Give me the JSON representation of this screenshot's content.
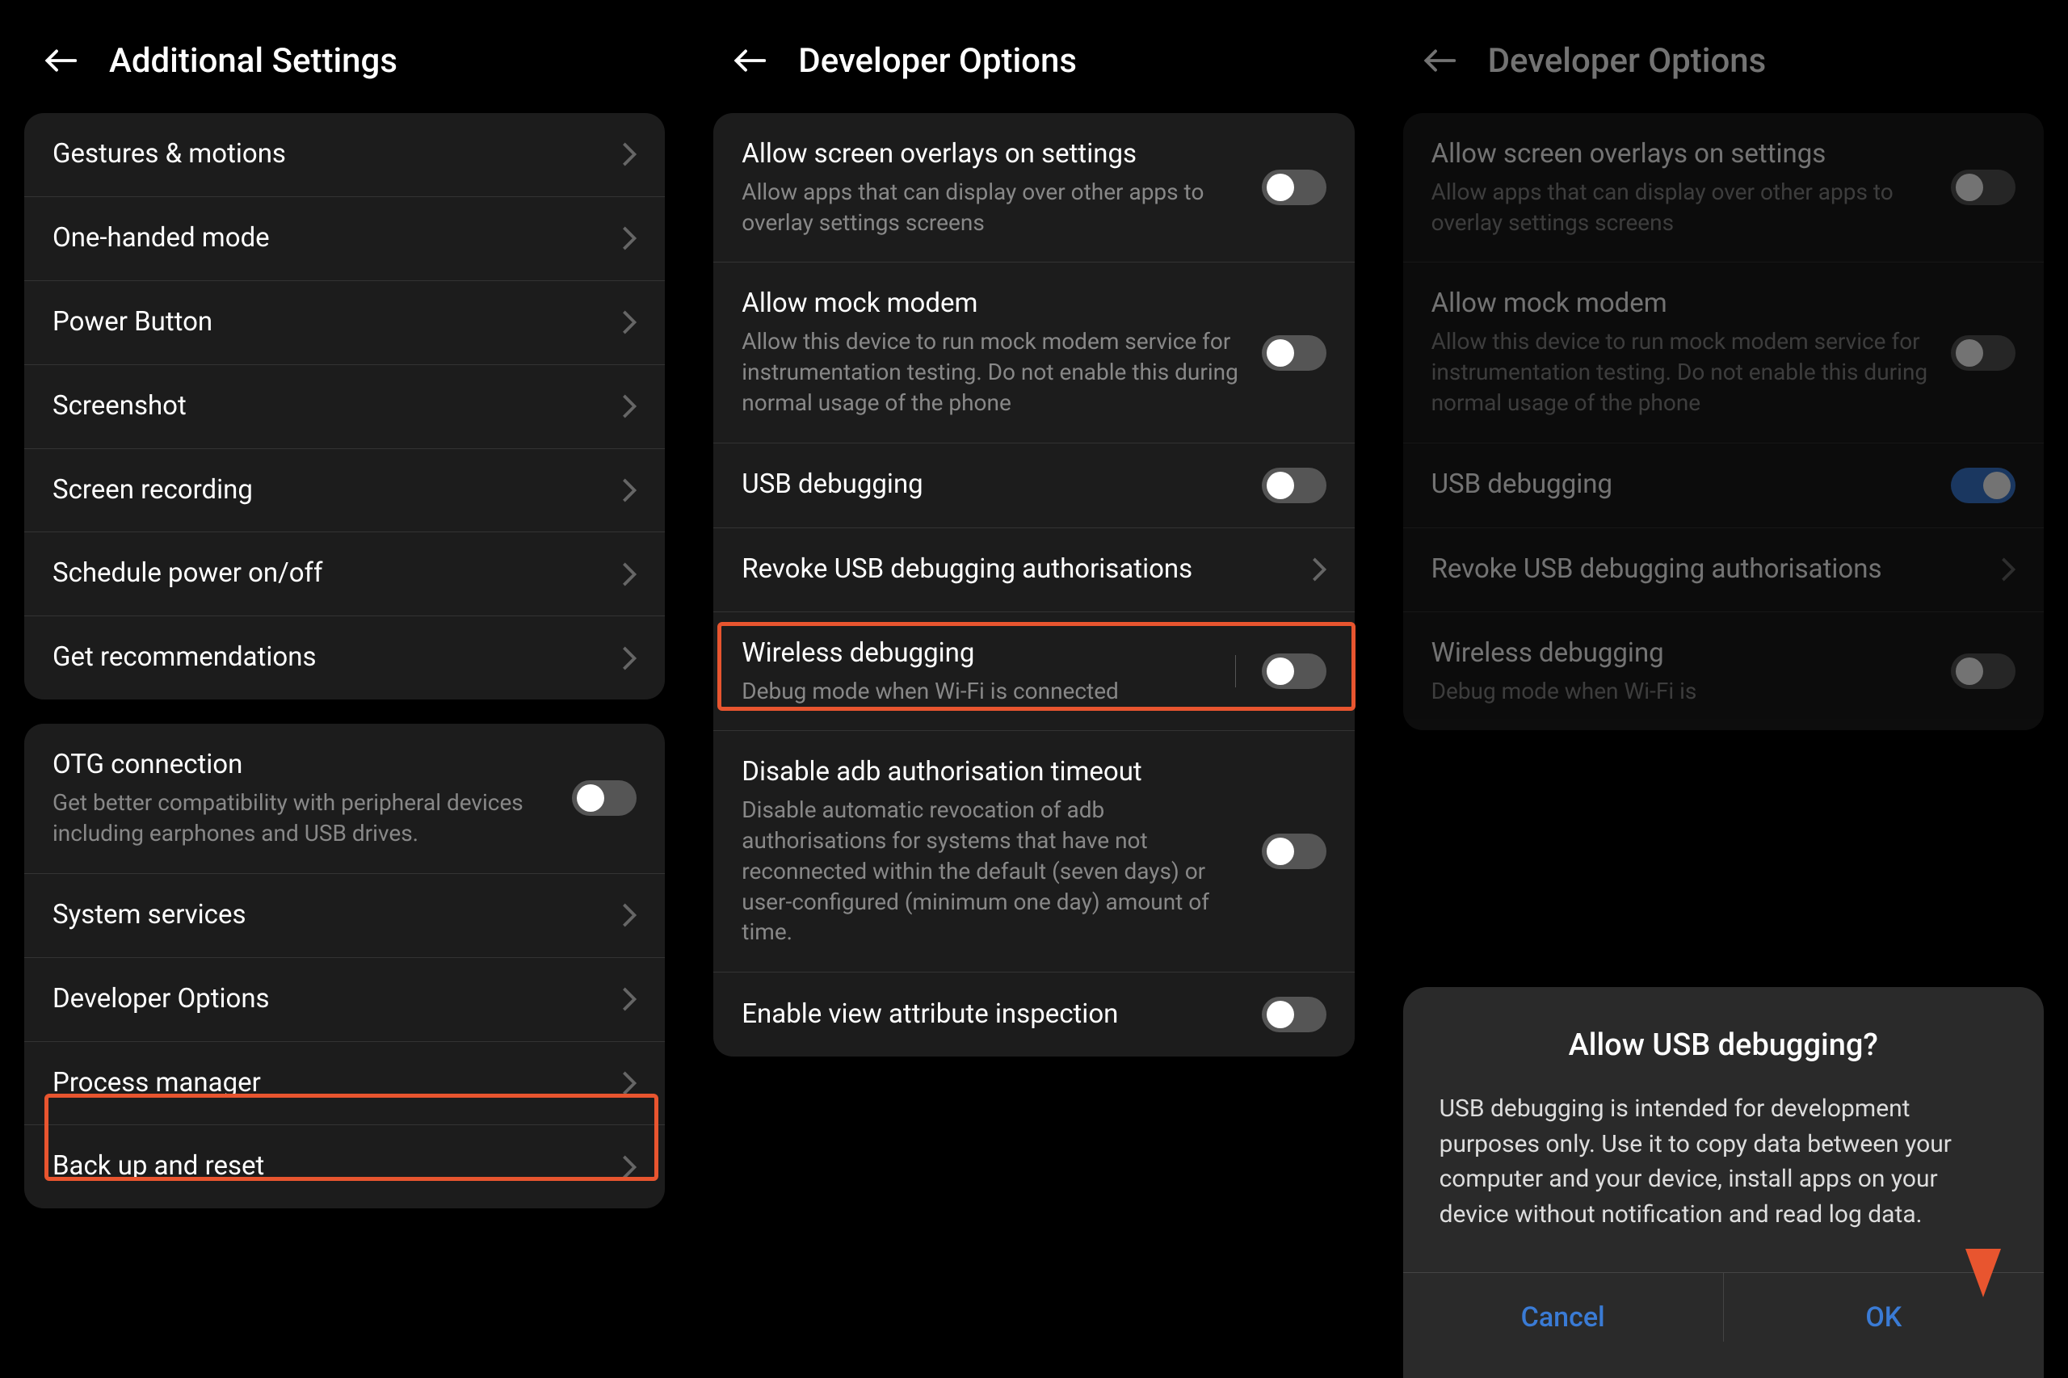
{
  "pane1": {
    "title": "Additional Settings",
    "group1": [
      {
        "label": "Gestures & motions"
      },
      {
        "label": "One-handed mode"
      },
      {
        "label": "Power Button"
      },
      {
        "label": "Screenshot"
      },
      {
        "label": "Screen recording"
      },
      {
        "label": "Schedule power on/off"
      },
      {
        "label": "Get recommendations"
      }
    ],
    "group2": [
      {
        "label": "OTG connection",
        "sub": "Get better compatibility with peripheral devices including earphones and USB drives.",
        "toggle": false
      },
      {
        "label": "System services"
      },
      {
        "label": "Developer Options"
      },
      {
        "label": "Process manager"
      },
      {
        "label": "Back up and reset"
      }
    ]
  },
  "pane2": {
    "title": "Developer Options",
    "items": [
      {
        "label": "Allow screen overlays on settings",
        "sub": "Allow apps that can display over other apps to overlay settings screens",
        "toggle": false
      },
      {
        "label": "Allow mock modem",
        "sub": "Allow this device to run mock modem service for instrumentation testing. Do not enable this during normal usage of the phone",
        "toggle": false
      },
      {
        "label": "USB debugging",
        "toggle": false
      },
      {
        "label": "Revoke USB debugging authorisations",
        "chevron": true
      },
      {
        "label": "Wireless debugging",
        "sub": "Debug mode when Wi-Fi is connected",
        "toggle": false,
        "vsep": true
      },
      {
        "label": "Disable adb authorisation timeout",
        "sub": "Disable automatic revocation of adb authorisations for systems that have not reconnected within the default (seven days) or user-configured (minimum one day) amount of time.",
        "toggle": false
      },
      {
        "label": "Enable view attribute inspection",
        "toggle": false
      }
    ]
  },
  "pane3": {
    "title": "Developer Options",
    "items": [
      {
        "label": "Allow screen overlays on settings",
        "sub": "Allow apps that can display over other apps to overlay settings screens",
        "toggle": false
      },
      {
        "label": "Allow mock modem",
        "sub": "Allow this device to run mock modem service for instrumentation testing. Do not enable this during normal usage of the phone",
        "toggle": false
      },
      {
        "label": "USB debugging",
        "toggle": true
      },
      {
        "label": "Revoke USB debugging authorisations",
        "chevron": true
      },
      {
        "label": "Wireless debugging",
        "sub": "Debug mode when Wi-Fi is",
        "toggle": false
      }
    ],
    "dialog": {
      "title": "Allow USB debugging?",
      "body": "USB debugging is intended for development purposes only. Use it to copy data between your computer and your device, install apps on your device without notification and read log data.",
      "cancel": "Cancel",
      "ok": "OK"
    }
  }
}
